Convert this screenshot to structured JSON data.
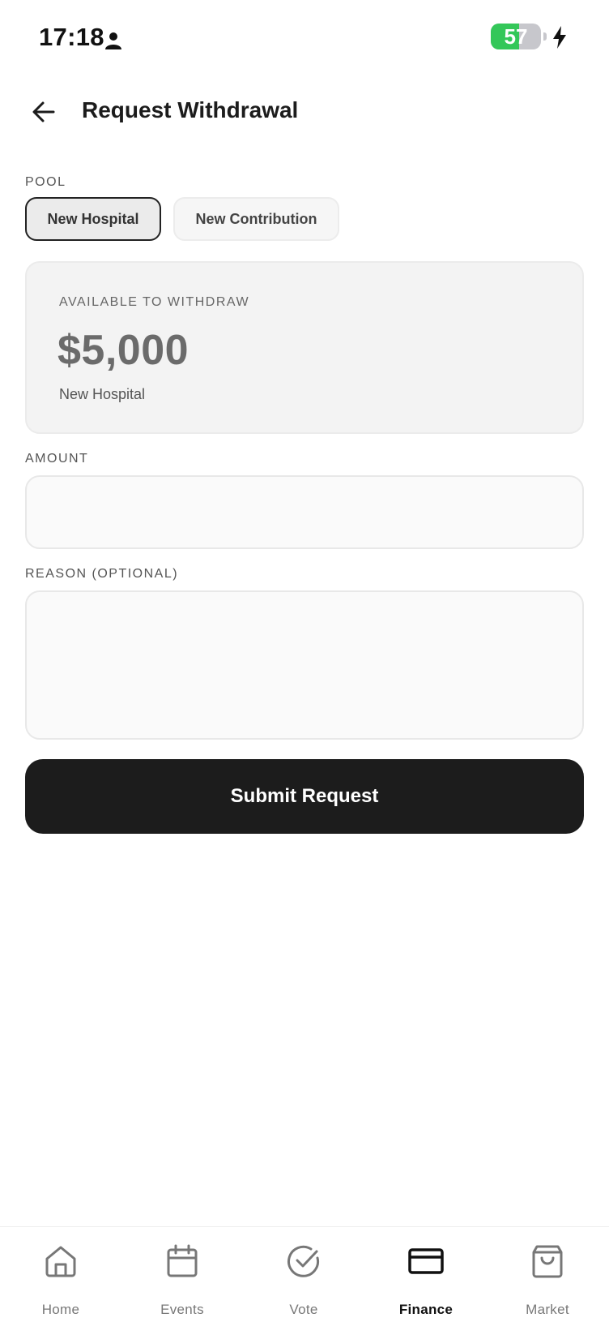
{
  "status_bar": {
    "time": "17:18",
    "battery_level": "57",
    "battery_fraction": 0.57
  },
  "header": {
    "title": "Request Withdrawal"
  },
  "pool": {
    "label": "POOL",
    "options": [
      "New Hospital",
      "New Contribution"
    ],
    "selected": "New Hospital"
  },
  "available": {
    "label": "AVAILABLE TO WITHDRAW",
    "amount": "$5,000",
    "pool_name": "New Hospital"
  },
  "amount_field": {
    "label": "AMOUNT",
    "value": "",
    "placeholder": ""
  },
  "reason_field": {
    "label": "REASON (OPTIONAL)",
    "value": "",
    "placeholder": ""
  },
  "submit": {
    "label": "Submit Request"
  },
  "nav": {
    "active": "Finance",
    "items": [
      {
        "label": "Home",
        "icon": "home-icon"
      },
      {
        "label": "Events",
        "icon": "calendar-icon"
      },
      {
        "label": "Vote",
        "icon": "check-circle-icon"
      },
      {
        "label": "Finance",
        "icon": "card-icon"
      },
      {
        "label": "Market",
        "icon": "shopping-bag-icon"
      }
    ]
  },
  "colors": {
    "battery_green": "#34c759",
    "primary_button": "#1c1c1c"
  }
}
